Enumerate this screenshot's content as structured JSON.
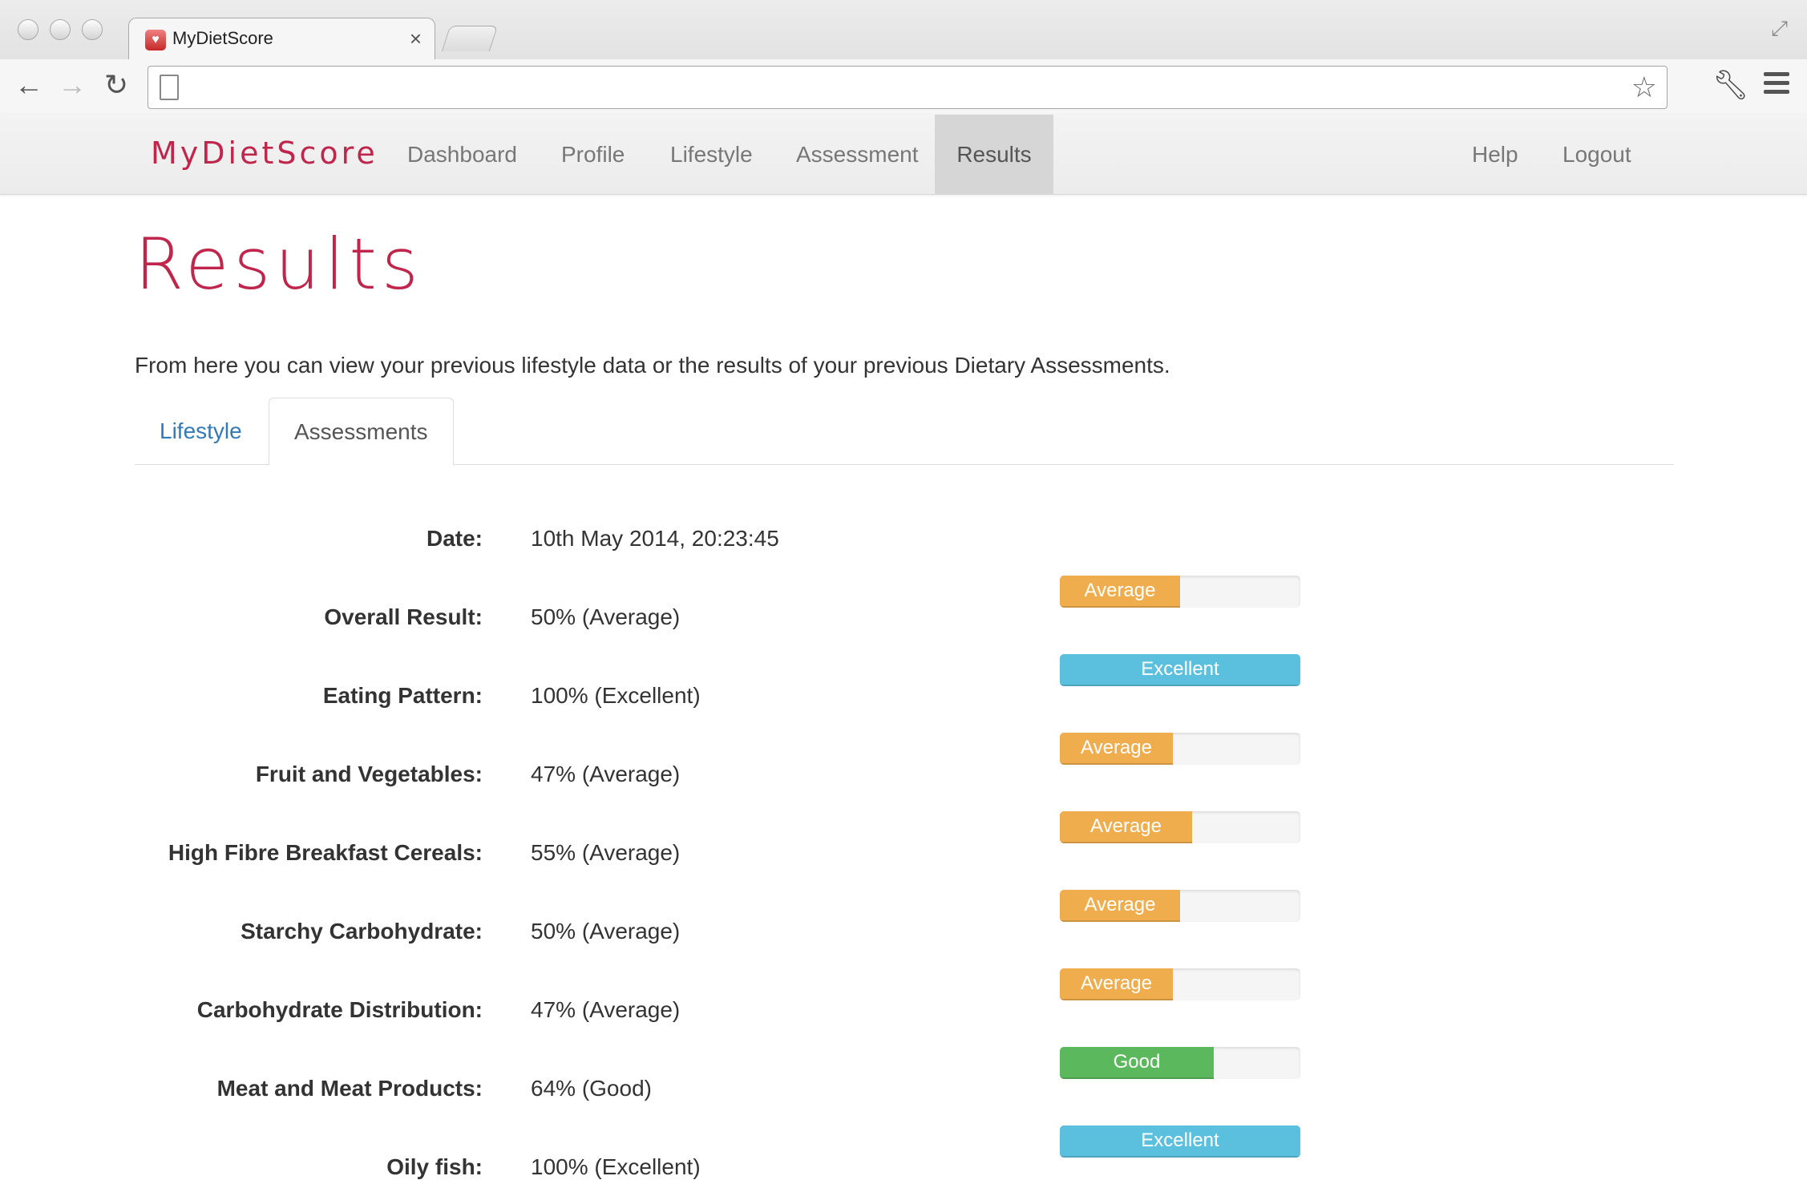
{
  "browser": {
    "tab_title": "MyDietScore",
    "tab_close": "×",
    "address_value": "",
    "icons": {
      "back": "back-arrow-icon",
      "forward": "forward-arrow-icon",
      "reload": "reload-icon",
      "star": "star-icon",
      "wrench": "wrench-icon",
      "menu": "menu-icon",
      "fullscreen": "fullscreen-icon"
    }
  },
  "navbar": {
    "brand": "MyDietScore",
    "items": [
      {
        "label": "Dashboard"
      },
      {
        "label": "Profile"
      },
      {
        "label": "Lifestyle"
      },
      {
        "label": "Assessment"
      },
      {
        "label": "Results"
      }
    ],
    "right_items": [
      {
        "label": "Help"
      },
      {
        "label": "Logout"
      }
    ],
    "active": "Results"
  },
  "page": {
    "title": "Results",
    "intro": "From here you can view your previous lifestyle data or the results of your previous Dietary Assessments.",
    "tabs": [
      {
        "label": "Lifestyle"
      },
      {
        "label": "Assessments"
      }
    ],
    "active_tab": "Assessments"
  },
  "assessment": {
    "date_label": "Date:",
    "date_value": "10th May 2014, 20:23:45",
    "rows": [
      {
        "label": "Overall Result:",
        "value": "50% (Average)",
        "percent": 50,
        "rating": "Average"
      },
      {
        "label": "Eating Pattern:",
        "value": "100% (Excellent)",
        "percent": 100,
        "rating": "Excellent"
      },
      {
        "label": "Fruit and Vegetables:",
        "value": "47% (Average)",
        "percent": 47,
        "rating": "Average"
      },
      {
        "label": "High Fibre Breakfast Cereals:",
        "value": "55% (Average)",
        "percent": 55,
        "rating": "Average"
      },
      {
        "label": "Starchy Carbohydrate:",
        "value": "50% (Average)",
        "percent": 50,
        "rating": "Average"
      },
      {
        "label": "Carbohydrate Distribution:",
        "value": "47% (Average)",
        "percent": 47,
        "rating": "Average"
      },
      {
        "label": "Meat and Meat Products:",
        "value": "64% (Good)",
        "percent": 64,
        "rating": "Good"
      },
      {
        "label": "Oily fish:",
        "value": "100% (Excellent)",
        "percent": 100,
        "rating": "Excellent"
      }
    ]
  },
  "colors": {
    "brand": "#c0264b",
    "Average": "#f0ad4e",
    "Excellent": "#5bc0de",
    "Good": "#5cb85c"
  }
}
